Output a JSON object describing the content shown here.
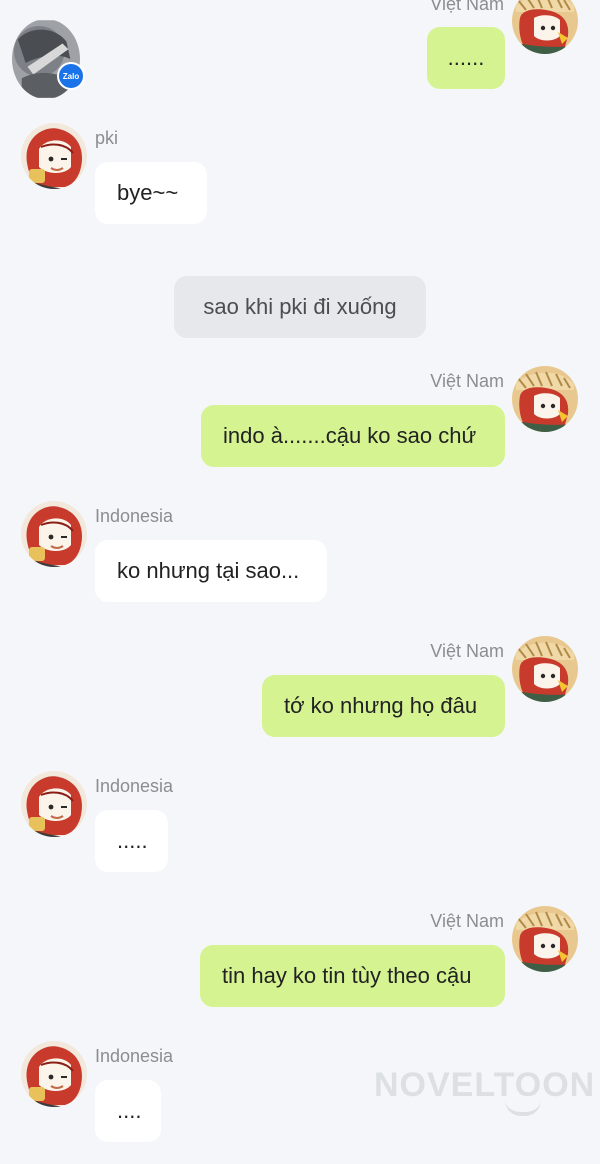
{
  "colors": {
    "background": "#f4f6f9",
    "incoming_bubble": "#ffffff",
    "outgoing_bubble": "#d5f491",
    "system_bubble": "#e6e8eb",
    "sender_name": "#8a8d92",
    "zalo_badge": "#1a73e8"
  },
  "messages": [
    {
      "sender": "Việt Nam",
      "text": "......"
    },
    {
      "sender": "pki",
      "text": "bye~~"
    },
    {
      "system_text": "sao khi pki đi xuống"
    },
    {
      "sender": "Việt Nam",
      "text": "indo à.......cậu ko sao chứ"
    },
    {
      "sender": "Indonesia",
      "text": "ko nhưng tại sao..."
    },
    {
      "sender": "Việt Nam",
      "text": "tớ ko nhưng họ đâu"
    },
    {
      "sender": "Indonesia",
      "text": "....."
    },
    {
      "sender": "Việt Nam",
      "text": "tin hay ko tin tùy theo cậu"
    },
    {
      "sender": "Indonesia",
      "text": "...."
    }
  ],
  "badge": {
    "label": "Zalo",
    "icon": "zalo-badge-icon"
  },
  "watermark": {
    "text": "NOVELTOON"
  }
}
